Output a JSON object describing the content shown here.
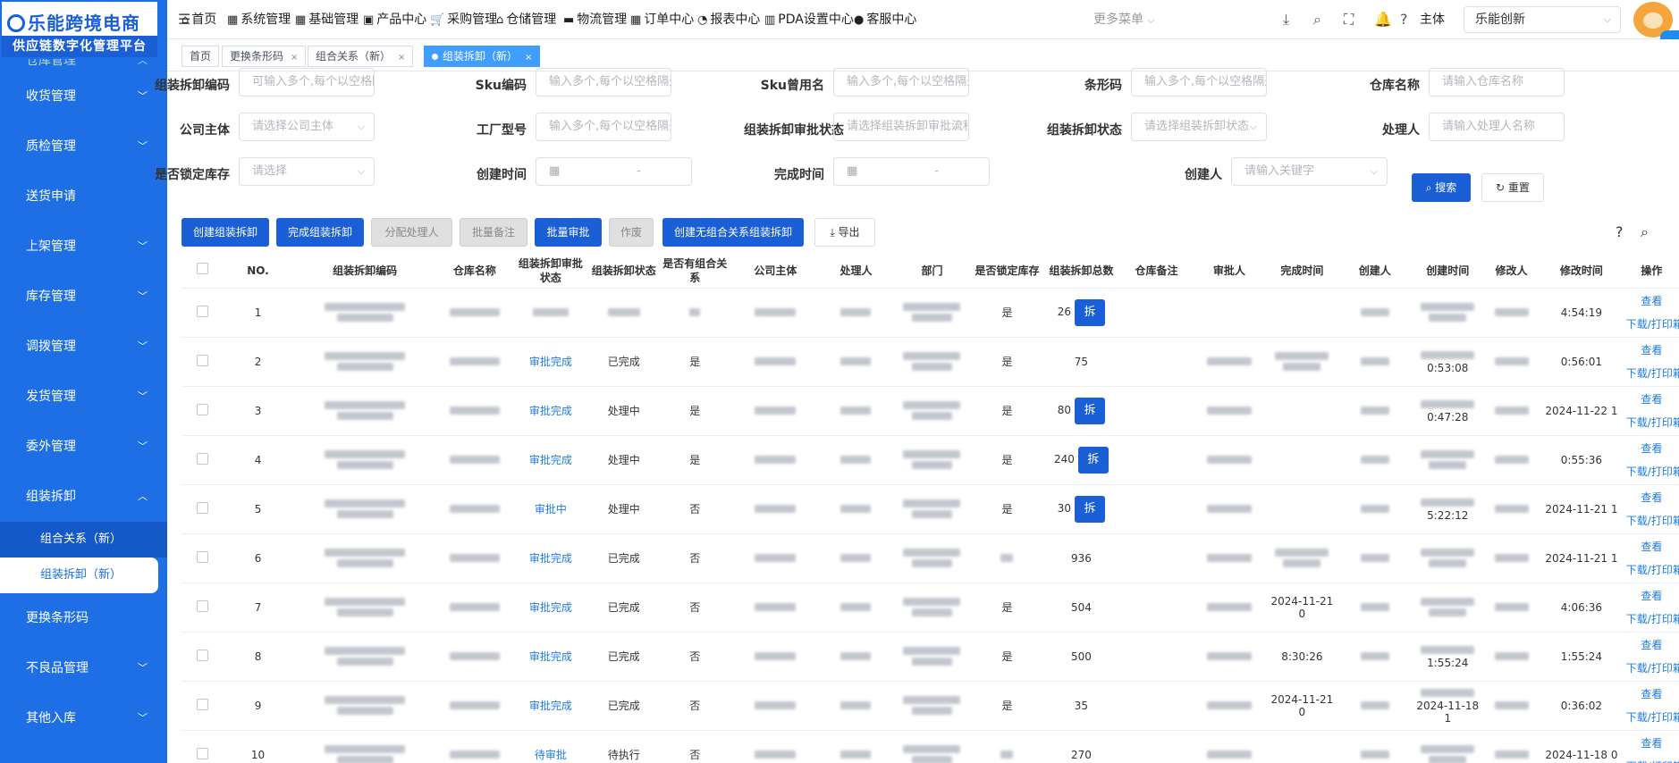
{
  "brand": {
    "line1": "乐能跨境电商",
    "line2": "供应链数字化管理平台"
  },
  "sidebar": {
    "items": [
      {
        "label": "仓库管理",
        "chevron": "up"
      },
      {
        "label": "收货管理",
        "chevron": "down"
      },
      {
        "label": "质检管理",
        "chevron": "down"
      },
      {
        "label": "送货申请",
        "chevron": ""
      },
      {
        "label": "上架管理",
        "chevron": "down"
      },
      {
        "label": "库存管理",
        "chevron": "down"
      },
      {
        "label": "调拨管理",
        "chevron": "down"
      },
      {
        "label": "发货管理",
        "chevron": "down"
      },
      {
        "label": "委外管理",
        "chevron": "down"
      },
      {
        "label": "组装拆卸",
        "chevron": "up"
      }
    ],
    "sub_items": [
      {
        "label": "组合关系（新）",
        "active": false
      },
      {
        "label": "组装拆卸（新）",
        "active": true
      }
    ],
    "items_after": [
      {
        "label": "更换条形码",
        "chevron": ""
      },
      {
        "label": "不良品管理",
        "chevron": "down"
      },
      {
        "label": "其他入库",
        "chevron": "down"
      }
    ]
  },
  "topnav": [
    {
      "icon": "home-icon",
      "glyph": "⌂",
      "label": "首页"
    },
    {
      "icon": "system-icon",
      "glyph": "▦",
      "label": "系统管理"
    },
    {
      "icon": "grid-icon",
      "glyph": "▦",
      "label": "基础管理"
    },
    {
      "icon": "product-icon",
      "glyph": "▣",
      "label": "产品中心"
    },
    {
      "icon": "cart-icon",
      "glyph": "🛒",
      "label": "采购管理"
    },
    {
      "icon": "warehouse-icon",
      "glyph": "⌂",
      "label": "仓储管理"
    },
    {
      "icon": "truck-icon",
      "glyph": "▬",
      "label": "物流管理"
    },
    {
      "icon": "order-icon",
      "glyph": "▦",
      "label": "订单中心"
    },
    {
      "icon": "report-icon",
      "glyph": "◔",
      "label": "报表中心"
    },
    {
      "icon": "pda-icon",
      "glyph": "▥",
      "label": "PDA设置中心"
    },
    {
      "icon": "user-icon",
      "glyph": "●",
      "label": "客服中心"
    }
  ],
  "more_menu": "更多菜单",
  "subject_label": "主体",
  "company": "乐能创新",
  "tabs": [
    {
      "label": "首页",
      "closable": false,
      "active": false
    },
    {
      "label": "更换条形码",
      "closable": true,
      "active": false
    },
    {
      "label": "组合关系（新）",
      "closable": true,
      "active": false
    },
    {
      "label": "组装拆卸（新）",
      "closable": true,
      "active": true
    }
  ],
  "filters": [
    {
      "label": "组装拆卸编码",
      "placeholder": "可输入多个,每个以空格隔",
      "type": "text"
    },
    {
      "label": "Sku编码",
      "placeholder": "输入多个,每个以空格隔开",
      "type": "text"
    },
    {
      "label": "Sku曾用名",
      "placeholder": "输入多个,每个以空格隔开",
      "type": "text"
    },
    {
      "label": "条形码",
      "placeholder": "输入多个,每个以空格隔开",
      "type": "text"
    },
    {
      "label": "仓库名称",
      "placeholder": "请输入仓库名称",
      "type": "text"
    },
    {
      "label": "公司主体",
      "placeholder": "请选择公司主体",
      "type": "select"
    },
    {
      "label": "工厂型号",
      "placeholder": "输入多个,每个以空格隔开",
      "type": "text"
    },
    {
      "label": "组装拆卸审批状态",
      "placeholder": "请选择组装拆卸审批流程状",
      "type": "select"
    },
    {
      "label": "组装拆卸状态",
      "placeholder": "请选择组装拆卸状态",
      "type": "select"
    },
    {
      "label": "处理人",
      "placeholder": "请输入处理人名称",
      "type": "text"
    },
    {
      "label": "是否锁定库存",
      "placeholder": "请选择",
      "type": "select"
    },
    {
      "label": "创建时间",
      "placeholder": "-",
      "type": "date"
    },
    {
      "label": "完成时间",
      "placeholder": "-",
      "type": "date"
    },
    {
      "label": "创建人",
      "placeholder": "请输入关键字",
      "type": "select"
    }
  ],
  "search_btn": "搜索",
  "reset_btn": "重置",
  "actions": [
    {
      "label": "创建组装拆卸",
      "style": "primary"
    },
    {
      "label": "完成组装拆卸",
      "style": "primary"
    },
    {
      "label": "分配处理人",
      "style": "disabled"
    },
    {
      "label": "批量备注",
      "style": "disabled"
    },
    {
      "label": "批量审批",
      "style": "primary"
    },
    {
      "label": "作废",
      "style": "disabled"
    },
    {
      "label": "创建无组合关系组装拆卸",
      "style": "primary"
    },
    {
      "label": "导出",
      "style": "ghost"
    }
  ],
  "table": {
    "columns": [
      "NO.",
      "组装拆卸编码",
      "仓库名称",
      "组装拆卸审批状态",
      "组装拆卸状态",
      "是否有组合关系",
      "公司主体",
      "处理人",
      "部门",
      "是否锁定库存",
      "组装拆卸总数",
      "仓库备注",
      "审批人",
      "完成时间",
      "创建人",
      "创建时间",
      "修改人",
      "修改时间",
      "操作"
    ],
    "rows": [
      {
        "no": "1",
        "approval": "",
        "status": "",
        "combo": "",
        "lock": "是",
        "total": "26",
        "chai": true,
        "finish_time": "",
        "modify_time": "4:54:19"
      },
      {
        "no": "2",
        "approval": "审批完成",
        "status": "已完成",
        "combo": "是",
        "lock": "是",
        "total": "75",
        "chai": false,
        "finish_time": "",
        "create_time": "0:53:08",
        "modify_time": "0:56:01"
      },
      {
        "no": "3",
        "approval": "审批完成",
        "status": "处理中",
        "combo": "是",
        "lock": "是",
        "total": "80",
        "chai": true,
        "finish_time": "",
        "create_time": "0:47:28",
        "modify_time": "2024-11-22 1"
      },
      {
        "no": "4",
        "approval": "审批完成",
        "status": "处理中",
        "combo": "是",
        "lock": "是",
        "total": "240",
        "chai": true,
        "finish_time": "",
        "modify_time": "0:55:36"
      },
      {
        "no": "5",
        "approval": "审批中",
        "status": "处理中",
        "combo": "否",
        "lock": "是",
        "total": "30",
        "chai": true,
        "finish_time": "",
        "create_time": "5:22:12",
        "modify_time": "2024-11-21 1"
      },
      {
        "no": "6",
        "approval": "审批完成",
        "status": "已完成",
        "combo": "否",
        "lock": "",
        "total": "936",
        "chai": false,
        "finish_time": "",
        "modify_time": "2024-11-21 1"
      },
      {
        "no": "7",
        "approval": "审批完成",
        "status": "已完成",
        "combo": "否",
        "lock": "是",
        "total": "504",
        "chai": false,
        "finish_time": "2024-11-21 0",
        "modify_time": "4:06:36"
      },
      {
        "no": "8",
        "approval": "审批完成",
        "status": "已完成",
        "combo": "否",
        "lock": "是",
        "total": "500",
        "chai": false,
        "finish_time": "8:30:26",
        "create_time": "1:55:24",
        "modify_time": "1:55:24"
      },
      {
        "no": "9",
        "approval": "审批完成",
        "status": "已完成",
        "combo": "否",
        "lock": "是",
        "total": "35",
        "chai": false,
        "finish_time": "2024-11-21 0",
        "create_time": "2024-11-18 1",
        "modify_time": "0:36:02"
      },
      {
        "no": "10",
        "approval": "待审批",
        "status": "待执行",
        "combo": "否",
        "lock": "",
        "total": "270",
        "chai": false,
        "finish_time": "",
        "modify_time": "2024-11-18 0"
      }
    ],
    "op_view": "查看",
    "op_print": "下载/打印箱贴",
    "chai_label": "拆"
  }
}
